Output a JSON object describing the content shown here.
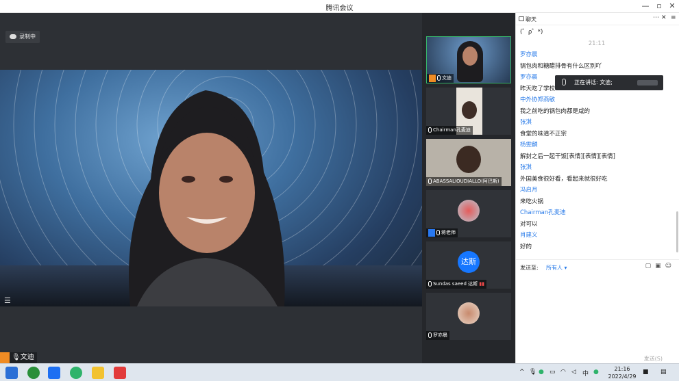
{
  "window": {
    "title": "腾讯会议",
    "controls": [
      "—",
      "▫",
      "✕"
    ]
  },
  "stage": {
    "recording_label": "录制中",
    "speaker_label": "文迪"
  },
  "thumbnails": [
    {
      "name": "文迪",
      "kind": "video",
      "active": true,
      "badge": "orange"
    },
    {
      "name": "Chairman孔麦迪",
      "kind": "video",
      "active": false,
      "badge": "none"
    },
    {
      "name": "ABASSALIOUDIALLO(阿巴斯)",
      "kind": "video",
      "active": false,
      "badge": "none"
    },
    {
      "name": "蒋老师",
      "kind": "avatar",
      "active": false,
      "badge": "blue"
    },
    {
      "name": "Sundas saeed  达斯",
      "kind": "text-avatar",
      "avatar_text": "达斯",
      "active": false,
      "badge": "none"
    },
    {
      "name": "罗亦晨",
      "kind": "avatar",
      "active": false,
      "badge": "none"
    }
  ],
  "chat": {
    "title": "聊天",
    "messages": [
      {
        "type": "text",
        "value": "(゜ρ゜*)"
      },
      {
        "type": "time",
        "value": "21:11"
      },
      {
        "type": "name",
        "value": "罗亦晨"
      },
      {
        "type": "text",
        "value": "锅包肉和糖醋排骨有什么区别吖"
      },
      {
        "type": "name",
        "value": "罗亦晨"
      },
      {
        "type": "text",
        "value": "昨天吃了学校"
      },
      {
        "type": "name",
        "value": "中外协郑燕敏"
      },
      {
        "type": "text",
        "value": "我之前吃的锅包肉都是咸的"
      },
      {
        "type": "name",
        "value": "张淇"
      },
      {
        "type": "text",
        "value": "食堂的味道不正宗"
      },
      {
        "type": "name",
        "value": "杨雯麟"
      },
      {
        "type": "text",
        "value": "解封之后一起干饭[表情][表情][表情]"
      },
      {
        "type": "name",
        "value": "张淇"
      },
      {
        "type": "text",
        "value": "外国美食很好看，看起来就很好吃"
      },
      {
        "type": "name",
        "value": "冯启月"
      },
      {
        "type": "text",
        "value": "来吃火锅"
      },
      {
        "type": "name",
        "value": "Chairman孔麦迪"
      },
      {
        "type": "text",
        "value": "对可以"
      },
      {
        "type": "name",
        "value": "肖建义"
      },
      {
        "type": "text",
        "value": "好的"
      }
    ],
    "speaking_tip": "正在讲话: 文迪;",
    "send_to_label": "发送至:",
    "send_to_target": "所有人",
    "send_button": "发送(S)"
  },
  "taskbar": {
    "time": "21:16",
    "date": "2022/4/29",
    "ime": "中"
  }
}
